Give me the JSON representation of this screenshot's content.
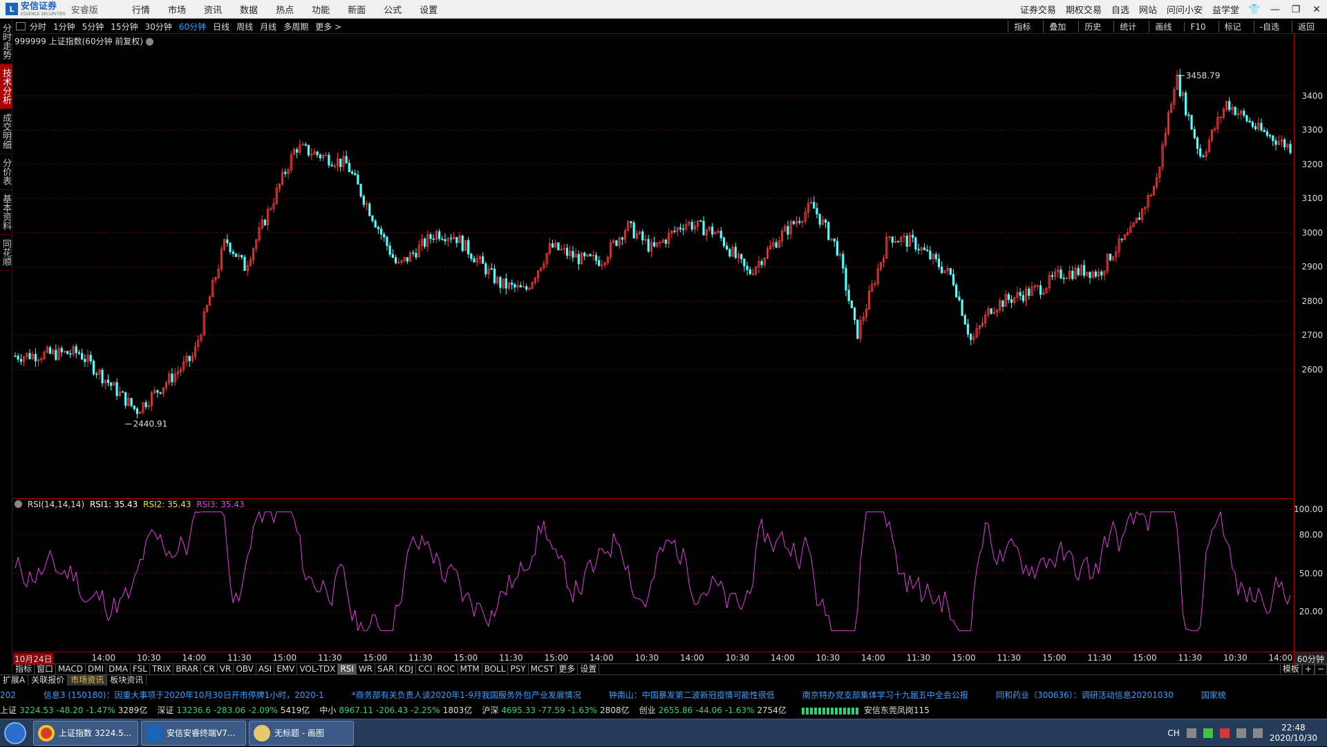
{
  "titlebar": {
    "brand": "安信证券",
    "brand_sub": "ESSENCE SECURITIES",
    "edition": "安睿版",
    "menu": [
      "行情",
      "市场",
      "资讯",
      "数据",
      "热点",
      "功能",
      "新面",
      "公式",
      "设置"
    ],
    "right": [
      "证券交易",
      "期权交易",
      "自选",
      "网站",
      "问问小安",
      "益学堂"
    ]
  },
  "sidebar": [
    "分时走势",
    "技术分析",
    "成交明细",
    "分价表",
    "基本资料",
    "同花顺"
  ],
  "periods": [
    "分时",
    "1分钟",
    "5分钟",
    "15分钟",
    "30分钟",
    "60分钟",
    "日线",
    "周线",
    "月线",
    "多周期",
    "更多 >"
  ],
  "active_period": "60分钟",
  "chart_tools": [
    "指标",
    "叠加",
    "历史",
    "统计",
    "画线",
    "F10",
    "标记",
    "-自选",
    "返回"
  ],
  "chart_title": "999999 上证指数(60分钟 前复权)",
  "price_axis": [
    "3400",
    "3300",
    "3200",
    "3100",
    "3000",
    "2900",
    "2800",
    "2700",
    "2600"
  ],
  "high_label": "3458.79",
  "low_label": "2440.91",
  "rsi_legend": {
    "name": "RSI(14,14,14)",
    "rsi1": "RSI1: 35.43",
    "rsi2": "RSI2: 35.43",
    "rsi3": "RSI3: 35.43"
  },
  "rsi_axis": [
    "100.00",
    "80.00",
    "50.00",
    "20.00"
  ],
  "time_labels": [
    "10月24日",
    "14:00",
    "10:30",
    "14:00",
    "11:30",
    "15:00",
    "11:30",
    "15:00",
    "11:30",
    "15:00",
    "11:30",
    "15:00",
    "14:00",
    "10:30",
    "14:00",
    "10:30",
    "14:00",
    "10:30",
    "14:00",
    "11:30",
    "15:00",
    "11:30",
    "15:00",
    "11:30",
    "15:00",
    "11:30",
    "10:30",
    "14:00"
  ],
  "time_period": "60分钟",
  "indicator_tabs": [
    "指标",
    "窗口",
    "MACD",
    "DMI",
    "DMA",
    "FSL",
    "TRIX",
    "BRAR",
    "CR",
    "VR",
    "OBV",
    "ASI",
    "EMV",
    "VOL-TDX",
    "RSI",
    "WR",
    "SAR",
    "KDJ",
    "CCI",
    "ROC",
    "MTM",
    "BOLL",
    "PSY",
    "MCST",
    "更多",
    "设置"
  ],
  "active_indicator": "RSI",
  "indicator_right": [
    "模板",
    "+",
    "−"
  ],
  "bottom_tabs": [
    "扩展A",
    "关联报价",
    "市场资讯",
    "板块资讯"
  ],
  "active_bottom_tab": "市场资讯",
  "news": [
    "202",
    "信息3 (150180)：因重大事项于2020年10月30日开市停牌1小时，2020-1",
    "*商务部有关负责人谈2020年1-9月我国服务外包产业发展情况",
    "钟南山：中国暴发第二波新冠疫情可能性很低",
    "南京特办党支部集体学习十九届五中全会公报",
    "同和药业（300636）：调研活动信息20201030",
    "国家统"
  ],
  "indices": [
    {
      "name": "上证",
      "value": "3224.53",
      "chg": "-48.20",
      "pct": "-1.47%",
      "amt": "3289亿"
    },
    {
      "name": "深证",
      "value": "13236.6",
      "chg": "-283.06",
      "pct": "-2.09%",
      "amt": "5419亿"
    },
    {
      "name": "中小",
      "value": "8967.11",
      "chg": "-206.43",
      "pct": "-2.25%",
      "amt": "1803亿"
    },
    {
      "name": "沪深",
      "value": "4695.33",
      "chg": "-77.59",
      "pct": "-1.63%",
      "amt": "2808亿"
    },
    {
      "name": "创业",
      "value": "2655.86",
      "chg": "-44.06",
      "pct": "-1.63%",
      "amt": "2754亿"
    }
  ],
  "broker": "安信东莞凤岗115",
  "taskbar": {
    "tasks": [
      "上证指数 3224.5...",
      "安信安睿终端V7...",
      "无标题 - 画图"
    ],
    "lang": "CH",
    "time": "22:48",
    "date": "2020/10/30"
  },
  "colors": {
    "up": "#ff3b3b",
    "down": "#54ffff",
    "rsi": "#e040e0",
    "grid": "#7a0000",
    "news": "#39a0ff",
    "negative": "#2ed17a"
  },
  "chart_data": {
    "type": "line",
    "series": [
      {
        "name": "上证指数 60分钟",
        "x": [
          0,
          0.05,
          0.095,
          0.14,
          0.165,
          0.18,
          0.22,
          0.26,
          0.3,
          0.33,
          0.345,
          0.38,
          0.4,
          0.42,
          0.445,
          0.46,
          0.48,
          0.5,
          0.525,
          0.55,
          0.575,
          0.6,
          0.625,
          0.645,
          0.66,
          0.685,
          0.705,
          0.735,
          0.75,
          0.765,
          0.775,
          0.79,
          0.805,
          0.82,
          0.84,
          0.85,
          0.86,
          0.875,
          0.895,
          0.91,
          0.93,
          0.95,
          0.975,
          1.0
        ],
        "values": [
          2640,
          2650,
          2480,
          2640,
          2980,
          2900,
          3250,
          3200,
          2900,
          3000,
          2990,
          2850,
          2830,
          2960,
          2920,
          2920,
          3020,
          2950,
          3030,
          3000,
          2880,
          2990,
          3080,
          2950,
          2700,
          2990,
          2970,
          2870,
          2680,
          2780,
          2800,
          2820,
          2840,
          2880,
          2890,
          2880,
          2940,
          3000,
          3150,
          3460,
          3220,
          3380,
          3300,
          3250
        ]
      }
    ],
    "extrema": {
      "high": 3458.79,
      "low": 2440.91
    },
    "ylim": [
      2400,
      3500
    ],
    "rsi_ylim": [
      0,
      100
    ]
  }
}
